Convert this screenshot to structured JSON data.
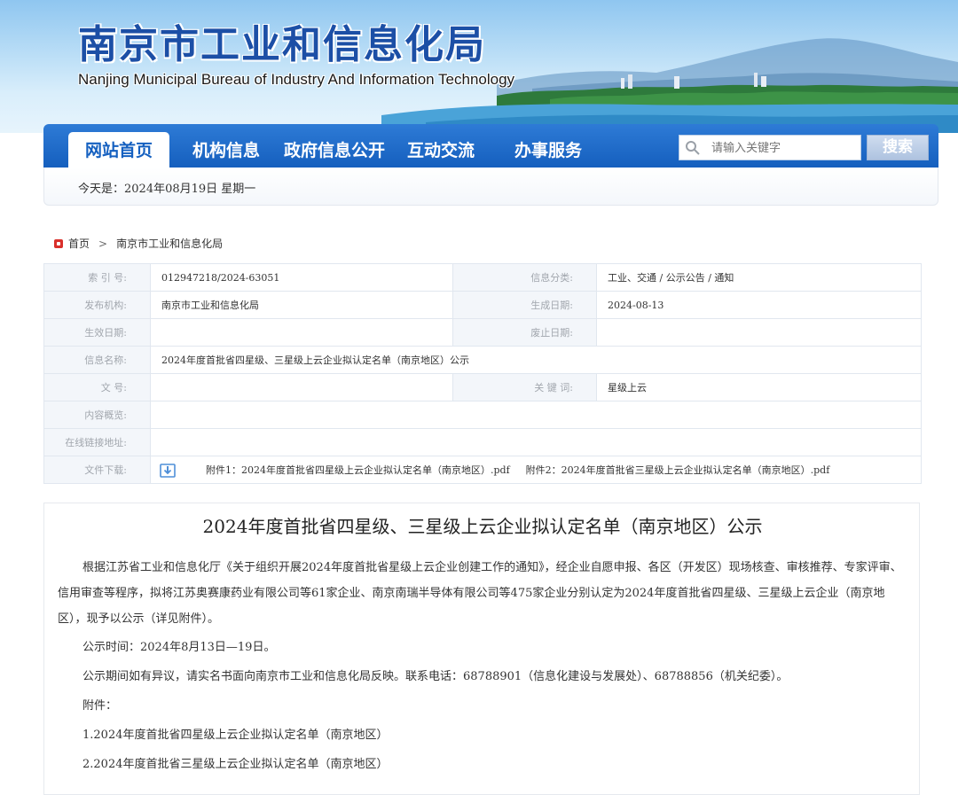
{
  "header": {
    "title": "南京市工业和信息化局",
    "subtitle": "Nanjing Municipal Bureau of Industry And Information Technology"
  },
  "nav": {
    "items": [
      {
        "label": "网站首页",
        "active": true
      },
      {
        "label": "机构信息"
      },
      {
        "label": "政府信息公开"
      },
      {
        "label": "互动交流"
      },
      {
        "label": "办事服务"
      }
    ],
    "search_placeholder": "请输入关键字",
    "search_button": "搜索"
  },
  "date_line": "今天是：2024年08月19日  星期一",
  "breadcrumb": [
    "首页",
    "南京市工业和信息化局"
  ],
  "meta": {
    "index_no_label": "索  引  号:",
    "index_no": "012947218/2024-63051",
    "category_label": "信息分类:",
    "category": "工业、交通 / 公示公告 / 通知",
    "publisher_label": "发布机构:",
    "publisher": "南京市工业和信息化局",
    "created_label": "生成日期:",
    "created": "2024-08-13",
    "effective_label": "生效日期:",
    "effective": "",
    "expired_label": "废止日期:",
    "expired": "",
    "name_label": "信息名称:",
    "name": "2024年度首批省四星级、三星级上云企业拟认定名单（南京地区）公示",
    "doc_no_label": "文      号:",
    "doc_no": "",
    "keywords_label": "关  键  词:",
    "keywords": "星级上云",
    "summary_label": "内容概览:",
    "summary": "",
    "link_label": "在线链接地址:",
    "link": "",
    "download_label": "文件下载:",
    "attachment1": "附件1：2024年度首批省四星级上云企业拟认定名单（南京地区）.pdf",
    "attachment2": "附件2：2024年度首批省三星级上云企业拟认定名单（南京地区）.pdf"
  },
  "article": {
    "title": "2024年度首批省四星级、三星级上云企业拟认定名单（南京地区）公示",
    "p1": "根据江苏省工业和信息化厅《关于组织开展2024年度首批省星级上云企业创建工作的通知》，经企业自愿申报、各区（开发区）现场核查、审核推荐、专家评审、信用审查等程序，拟将江苏奥赛康药业有限公司等61家企业、南京南瑞半导体有限公司等475家企业分别认定为2024年度首批省四星级、三星级上云企业（南京地区），现予以公示（详见附件）。",
    "p2": "公示时间：2024年8月13日—19日。",
    "p3": "公示期间如有异议，请实名书面向南京市工业和信息化局反映。联系电话：68788901（信息化建设与发展处）、68788856（机关纪委）。",
    "p4": "附件：",
    "p5": "1.2024年度首批省四星级上云企业拟认定名单（南京地区）",
    "p6": "2.2024年度首批省三星级上云企业拟认定名单（南京地区）"
  }
}
